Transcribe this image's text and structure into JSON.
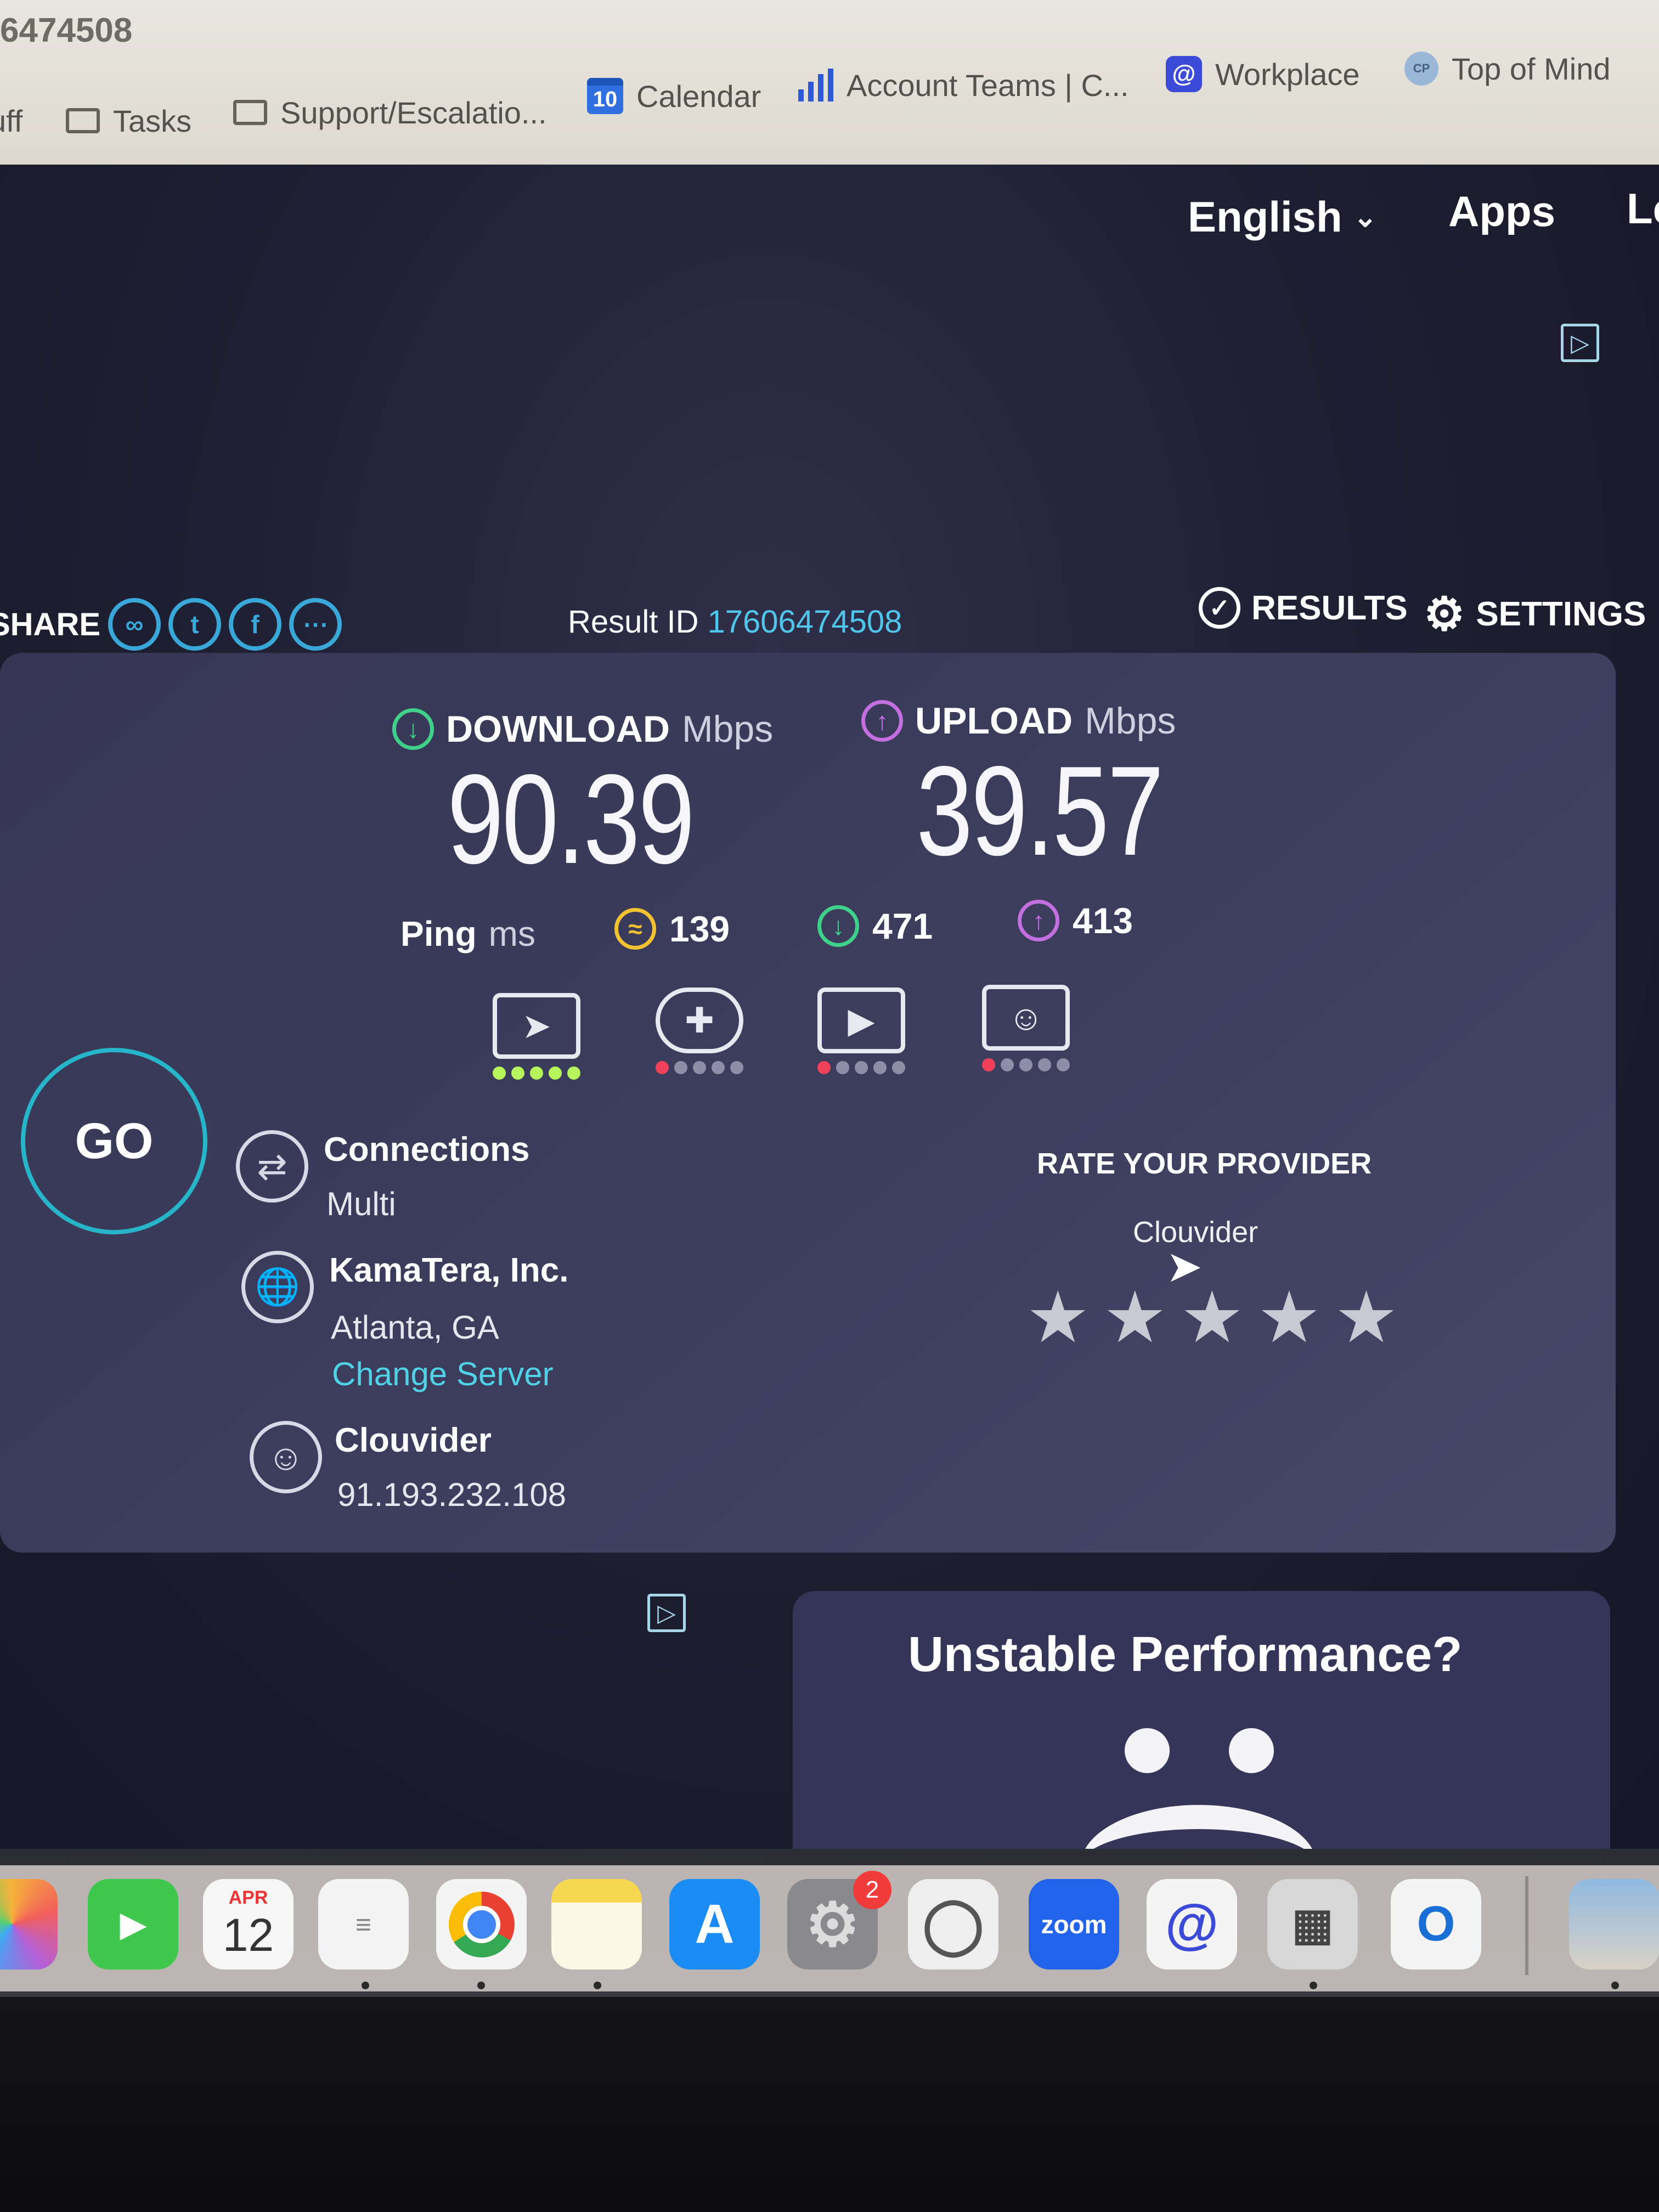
{
  "browser": {
    "url_fragment": "6474508",
    "bookmarks": [
      {
        "label": "uff",
        "icon": "folder-icon"
      },
      {
        "label": "Tasks",
        "icon": "folder-icon"
      },
      {
        "label": "Support/Escalatio...",
        "icon": "folder-icon"
      },
      {
        "label": "Calendar",
        "icon": "calendar-icon",
        "icon_text": "10"
      },
      {
        "label": "Account Teams | C...",
        "icon": "bar-chart-icon"
      },
      {
        "label": "Workplace",
        "icon": "workplace-icon"
      },
      {
        "label": "Top of Mind",
        "icon": "team-icon"
      }
    ]
  },
  "nav": {
    "language": "English",
    "apps": "Apps",
    "cut_link": "Le"
  },
  "share": {
    "label": "SHARE"
  },
  "result": {
    "label": "Result ID",
    "id": "17606474508",
    "results_label": "RESULTS",
    "settings_label": "SETTINGS"
  },
  "speed": {
    "download_label": "DOWNLOAD",
    "download_unit": "Mbps",
    "download_value": "90.39",
    "upload_label": "UPLOAD",
    "upload_unit": "Mbps",
    "upload_value": "39.57",
    "ping_label": "Ping",
    "ping_unit": "ms",
    "ping_idle": "139",
    "ping_download": "471",
    "ping_upload": "413"
  },
  "usage_ratings": [
    {
      "name": "web-browsing",
      "level": 5
    },
    {
      "name": "gaming",
      "level": 1
    },
    {
      "name": "streaming",
      "level": 1
    },
    {
      "name": "video-calling",
      "level": 1
    }
  ],
  "go_label": "GO",
  "connections": {
    "title": "Connections",
    "value": "Multi"
  },
  "server": {
    "name": "KamaTera, Inc.",
    "location": "Atlanta, GA",
    "change_label": "Change Server"
  },
  "provider": {
    "name": "Clouvider",
    "ip": "91.193.232.108"
  },
  "rate": {
    "title": "RATE YOUR PROVIDER",
    "provider": "Clouvider",
    "stars": 5
  },
  "promo": {
    "title": "Unstable Performance?"
  },
  "dock": {
    "calendar_month": "APR",
    "calendar_day": "12",
    "settings_badge": "2",
    "zoom_label": "zoom"
  },
  "colors": {
    "accent_teal": "#27b6c9",
    "download_green": "#3fd08a",
    "upload_purple": "#c46fe0",
    "ping_yellow": "#f2c230",
    "link_cyan": "#4fd2e6",
    "good_dot": "#b6f55c",
    "bad_dot": "#f0405a"
  }
}
